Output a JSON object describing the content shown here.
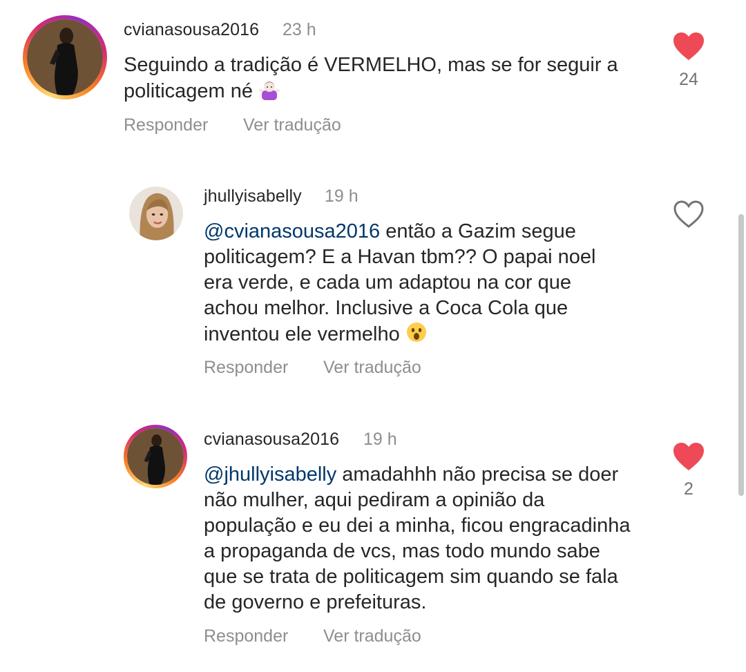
{
  "comments": [
    {
      "username": "cvianasousa2016",
      "time": "23 h",
      "text": "Seguindo a tradição é VERMELHO, mas se for seguir a politicagem né",
      "emoji": "person-shrugging-emoji",
      "liked": true,
      "like_count": "24",
      "reply_label": "Responder",
      "translate_label": "Ver tradução"
    },
    {
      "username": "jhullyisabelly",
      "time": "19 h",
      "mention": "@cvianasousa2016",
      "text": " então a Gazim segue politicagem? E a Havan tbm?? O papai noel era verde, e cada um adaptou na cor que achou melhor. Inclusive a Coca Cola que inventou ele vermelho",
      "emoji": "astonished-face-emoji",
      "liked": false,
      "like_count": "",
      "reply_label": "Responder",
      "translate_label": "Ver tradução"
    },
    {
      "username": "cvianasousa2016",
      "time": "19 h",
      "mention": "@jhullyisabelly",
      "text": " amadahhh não precisa se doer não mulher, aqui pediram a opinião da população e eu dei a minha, ficou engracadinha a propaganda de vcs, mas todo mundo sabe que se trata de politicagem sim quando se fala de governo e prefeituras.",
      "liked": true,
      "like_count": "2",
      "reply_label": "Responder",
      "translate_label": "Ver tradução"
    }
  ],
  "colors": {
    "liked_heart": "#ed4956",
    "mention": "#00376b",
    "secondary_text": "#8e8e8e"
  }
}
